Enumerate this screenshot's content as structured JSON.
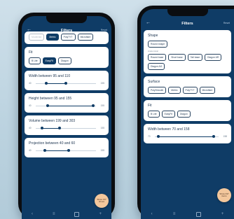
{
  "left_phone": {
    "appbar": {
      "title": "Filters",
      "reset": "Reset"
    },
    "shape_partial": {
      "chips": [
        {
          "label": "Moderate",
          "selected": false
        },
        {
          "label": "Metric",
          "selected": true
        },
        {
          "label": "PolyTYT",
          "selected": false
        }
      ],
      "extra_chip": "Microflare"
    },
    "fit": {
      "title": "Fit",
      "chips": [
        {
          "label": "B Lite",
          "selected": false
        },
        {
          "label": "EasyFit",
          "selected": true
        },
        {
          "label": "Diagon",
          "selected": false
        }
      ]
    },
    "sliders": [
      {
        "title": "Width between 95 and 110",
        "lo": "40",
        "hi": "155"
      },
      {
        "title": "Height between 95 and 155",
        "lo": "40",
        "hi": "155"
      },
      {
        "title": "Volume between 199 and 303",
        "lo": "40",
        "hi": "155"
      },
      {
        "title": "Projection between 40 and 60",
        "lo": "40",
        "hi": "155"
      }
    ],
    "fab": "Show 137 shoes"
  },
  "right_phone": {
    "appbar": {
      "title": "Filters",
      "reset": "Reset"
    },
    "shape": {
      "title": "Shape",
      "chips": [
        {
          "label": "Round shape",
          "selected": false
        }
      ],
      "sub": "Anatomical",
      "anatomical_chips": [
        {
          "label": "Round base",
          "selected": false
        },
        {
          "label": "Short base",
          "selected": false
        },
        {
          "label": "Tall base",
          "selected": false
        },
        {
          "label": "Diagon AR",
          "selected": false
        },
        {
          "label": "Diagon AG",
          "selected": false
        }
      ]
    },
    "surface": {
      "title": "Surface",
      "chips": [
        {
          "label": "PolySmooth",
          "selected": false
        },
        {
          "label": "Metric",
          "selected": false
        },
        {
          "label": "PolyTYT",
          "selected": false
        },
        {
          "label": "Microflare",
          "selected": false
        }
      ]
    },
    "fit": {
      "title": "Fit",
      "chips": [
        {
          "label": "B Lite",
          "selected": false
        },
        {
          "label": "EasyFit",
          "selected": false
        },
        {
          "label": "Diagon",
          "selected": false
        }
      ]
    },
    "width": {
      "title": "Width between 70 and 158",
      "lo": "70",
      "hi": "158"
    },
    "fab": "Show 337 items"
  },
  "colors": {
    "primary": "#0f3c66",
    "accent": "#f3c79c",
    "background": "#c9dce7"
  }
}
